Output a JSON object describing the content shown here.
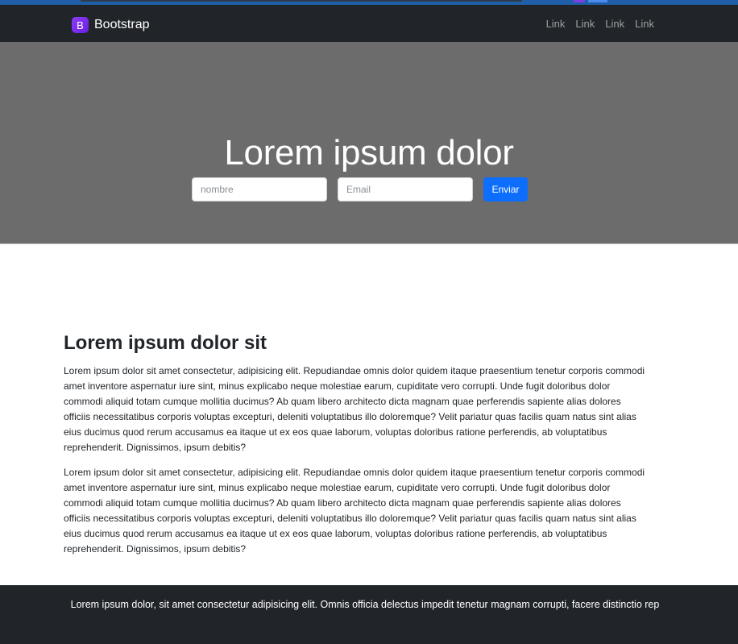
{
  "navbar": {
    "brand_icon": "B",
    "brand_text": "Bootstrap",
    "links": [
      "Link",
      "Link",
      "Link",
      "Link"
    ]
  },
  "hero": {
    "title": "Lorem ipsum dolor",
    "name_placeholder": "nombre",
    "email_placeholder": "Email",
    "submit_label": "Enviar"
  },
  "content": {
    "heading": "Lorem ipsum dolor sit",
    "paragraphs": [
      "Lorem ipsum dolor sit amet consectetur, adipisicing elit. Repudiandae omnis dolor quidem itaque praesentium tenetur corporis commodi amet inventore aspernatur iure sint, minus explicabo neque molestiae earum, cupiditate vero corrupti. Unde fugit doloribus dolor commodi aliquid totam cumque mollitia ducimus? Ab quam libero architecto dicta magnam quae perferendis sapiente alias dolores officiis necessitatibus corporis voluptas excepturi, deleniti voluptatibus illo doloremque? Velit pariatur quas facilis quam natus sint alias eius ducimus quod rerum accusamus ea itaque ut ex eos quae laborum, voluptas doloribus ratione perferendis, ab voluptatibus reprehenderit. Dignissimos, ipsum debitis?",
      "Lorem ipsum dolor sit amet consectetur, adipisicing elit. Repudiandae omnis dolor quidem itaque praesentium tenetur corporis commodi amet inventore aspernatur iure sint, minus explicabo neque molestiae earum, cupiditate vero corrupti. Unde fugit doloribus dolor commodi aliquid totam cumque mollitia ducimus? Ab quam libero architecto dicta magnam quae perferendis sapiente alias dolores officiis necessitatibus corporis voluptas excepturi, deleniti voluptatibus illo doloremque? Velit pariatur quas facilis quam natus sint alias eius ducimus quod rerum accusamus ea itaque ut ex eos quae laborum, voluptas doloribus ratione perferendis, ab voluptatibus reprehenderit. Dignissimos, ipsum debitis?"
    ]
  },
  "footer": {
    "text": "Lorem ipsum dolor, sit amet consectetur adipisicing elit. Omnis officia delectus impedit tenetur magnam corrupti, facere distinctio rep"
  },
  "colors": {
    "navbar_bg": "#212529",
    "hero_bg": "#6c6c6c",
    "primary": "#0d6efd",
    "brand_purple": "#7b2ff7"
  },
  "icons": {
    "brand": "bootstrap-logo-icon"
  }
}
